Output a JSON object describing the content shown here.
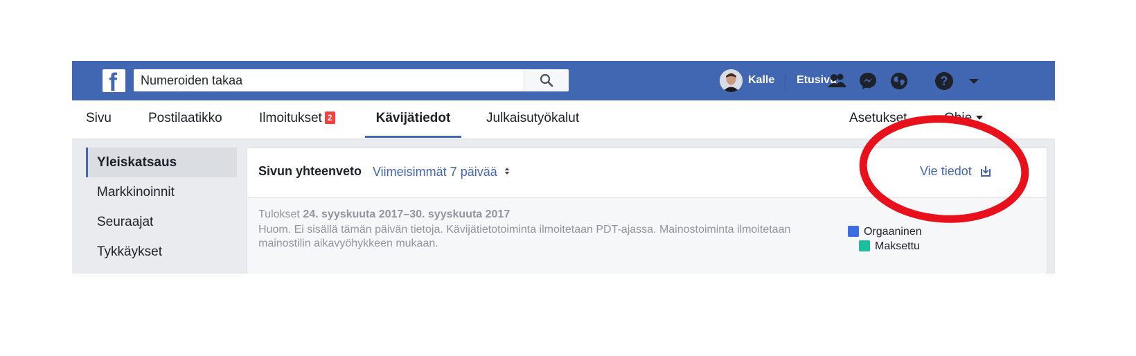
{
  "topbar": {
    "search_value": "Numeroiden takaa",
    "user_name": "Kalle",
    "home_label": "Etusivu",
    "brand_color": "#4267b2"
  },
  "tabs": [
    {
      "label": "Sivu"
    },
    {
      "label": "Postilaatikko"
    },
    {
      "label": "Ilmoitukset",
      "badge": "2"
    },
    {
      "label": "Kävijätiedot",
      "active": true
    },
    {
      "label": "Julkaisutyökalut"
    }
  ],
  "right_tabs": {
    "settings": "Asetukset",
    "help": "Ohje"
  },
  "sidebar": {
    "items": [
      {
        "label": "Yleiskatsaus",
        "active": true
      },
      {
        "label": "Markkinoinnit"
      },
      {
        "label": "Seuraajat"
      },
      {
        "label": "Tykkäykset"
      }
    ]
  },
  "summary": {
    "title": "Sivun yhteenveto",
    "period": "Viimeisimmät 7 päivää",
    "export_label": "Vie tiedot",
    "results_prefix": "Tulokset",
    "results_range": "24. syyskuuta 2017–30. syyskuuta 2017",
    "note": "Huom. Ei sisällä tämän päivän tietoja. Kävijätietotoiminta ilmoitetaan PDT-ajassa. Mainostoiminta ilmoitetaan mainostilin aikavyöhykkeen mukaan.",
    "legend": [
      {
        "label": "Orgaaninen",
        "color": "#3b6ee0"
      },
      {
        "label": "Maksettu",
        "color": "#1cbf9c"
      }
    ]
  },
  "annotation_color": "#e8101b"
}
